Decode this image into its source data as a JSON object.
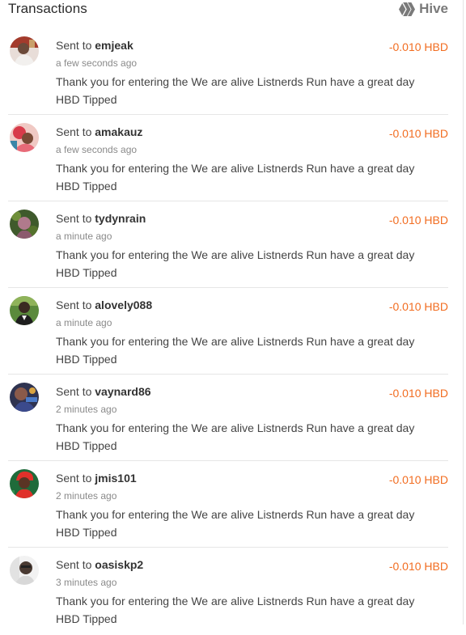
{
  "header": {
    "title": "Transactions",
    "chain_label": "Hive",
    "chain_icon": "hive-logo-icon"
  },
  "colors": {
    "amount": "#f26d21",
    "divider": "#e6e6e6"
  },
  "transactions": [
    {
      "prefix": "Sent to",
      "user": "emjeak",
      "amount": "-0.010 HBD",
      "time": "a few seconds ago",
      "memo": "Thank you for entering the We are alive Listnerds Run have a great day HBD Tipped",
      "avatar_icon": "avatar-emjeak"
    },
    {
      "prefix": "Sent to",
      "user": "amakauz",
      "amount": "-0.010 HBD",
      "time": "a few seconds ago",
      "memo": "Thank you for entering the We are alive Listnerds Run have a great day HBD Tipped",
      "avatar_icon": "avatar-amakauz"
    },
    {
      "prefix": "Sent to",
      "user": "tydynrain",
      "amount": "-0.010 HBD",
      "time": "a minute ago",
      "memo": "Thank you for entering the We are alive Listnerds Run have a great day HBD Tipped",
      "avatar_icon": "avatar-tydynrain"
    },
    {
      "prefix": "Sent to",
      "user": "alovely088",
      "amount": "-0.010 HBD",
      "time": "a minute ago",
      "memo": "Thank you for entering the We are alive Listnerds Run have a great day HBD Tipped",
      "avatar_icon": "avatar-alovely088"
    },
    {
      "prefix": "Sent to",
      "user": "vaynard86",
      "amount": "-0.010 HBD",
      "time": "2 minutes ago",
      "memo": "Thank you for entering the We are alive Listnerds Run have a great day HBD Tipped",
      "avatar_icon": "avatar-vaynard86"
    },
    {
      "prefix": "Sent to",
      "user": "jmis101",
      "amount": "-0.010 HBD",
      "time": "2 minutes ago",
      "memo": "Thank you for entering the We are alive Listnerds Run have a great day HBD Tipped",
      "avatar_icon": "avatar-jmis101"
    },
    {
      "prefix": "Sent to",
      "user": "oasiskp2",
      "amount": "-0.010 HBD",
      "time": "3 minutes ago",
      "memo": "Thank you for entering the We are alive Listnerds Run have a great day HBD Tipped",
      "avatar_icon": "avatar-oasiskp2"
    }
  ]
}
